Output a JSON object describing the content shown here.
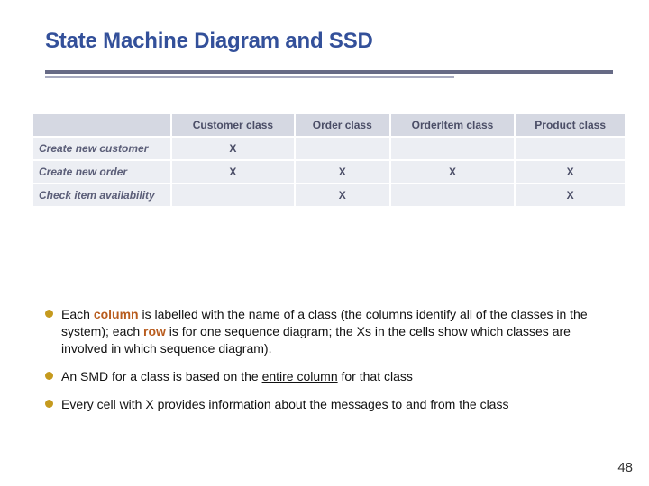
{
  "title": "State Machine Diagram and SSD",
  "table": {
    "headers": [
      "",
      "Customer class",
      "Order class",
      "OrderItem class",
      "Product class"
    ],
    "rows": [
      {
        "label": "Create new customer",
        "cells": [
          "X",
          "",
          "",
          ""
        ]
      },
      {
        "label": "Create new order",
        "cells": [
          "X",
          "X",
          "X",
          "X"
        ]
      },
      {
        "label": "Check item availability",
        "cells": [
          "",
          "X",
          "",
          "X"
        ]
      }
    ]
  },
  "bullets": {
    "b1": {
      "lead": "Each ",
      "col_word": "column",
      "mid1": " is labelled with the name of a class (the columns identify all of the classes in the system); each ",
      "row_word": "row",
      "mid2": " is for one sequence diagram; the Xs in the cells show which classes are involved in which sequence diagram)."
    },
    "b2": {
      "pre": " An SMD for a class is based on the ",
      "u": "entire column",
      "post": " for that class"
    },
    "b3": " Every cell with X provides information about the messages to and from the class"
  },
  "slide_number": "48"
}
